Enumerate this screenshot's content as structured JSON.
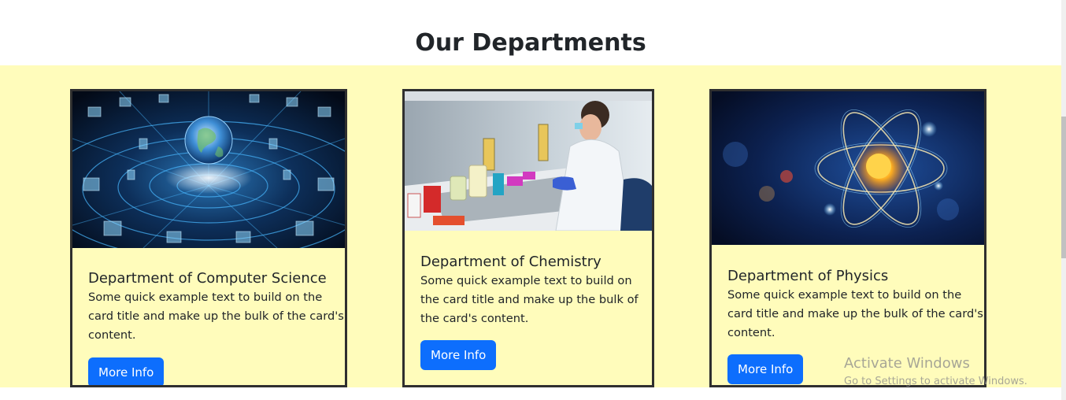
{
  "section": {
    "title": "Our Departments"
  },
  "cards": [
    {
      "title": "Department of Computer Science",
      "text": "Some quick example text to build on the card title and make up the bulk of the card's content.",
      "button": "More Info"
    },
    {
      "title": "Department of Chemistry",
      "text": "Some quick example text to build on the card title and make up the bulk of the card's content.",
      "button": "More Info"
    },
    {
      "title": "Department of Physics",
      "text": "Some quick example text to build on the card title and make up the bulk of the card's content.",
      "button": "More Info"
    }
  ],
  "watermark": {
    "line1": "Activate Windows",
    "line2": "Go to Settings to activate Windows."
  },
  "colors": {
    "band_background": "#fffcbb",
    "button": "#0d6efd",
    "card_border": "#2f2f2f"
  },
  "images": {
    "card1": "network-globe-image",
    "card2": "lab-scientist-image",
    "card3": "atom-image"
  }
}
